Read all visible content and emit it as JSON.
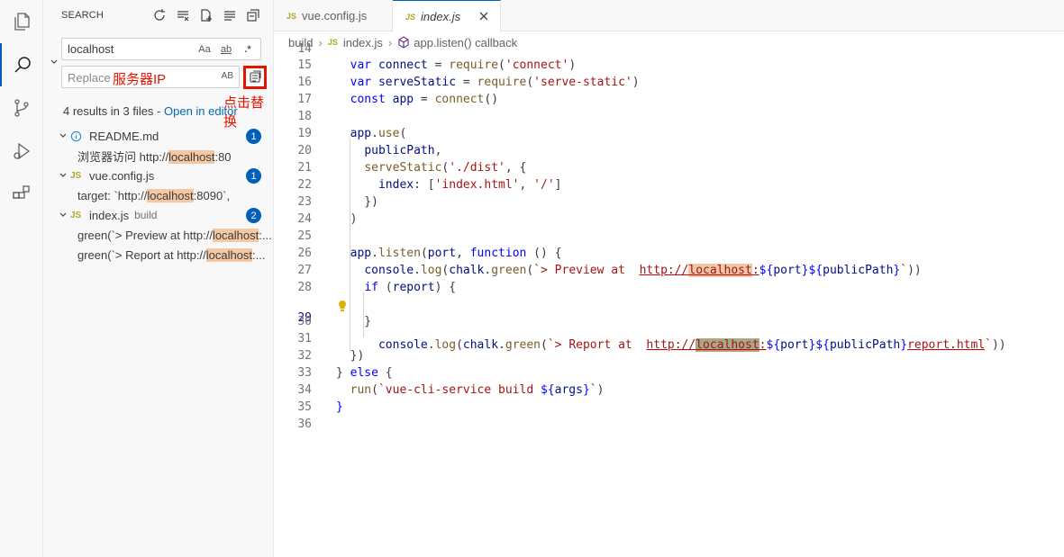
{
  "sidebar": {
    "title": "SEARCH",
    "search_value": "localhost",
    "search_opts": [
      "Aa",
      "ab",
      ".*"
    ],
    "replace_placeholder": "Replace",
    "replace_annotation": "服务器IP",
    "replace_ab": "AB",
    "replace_all_annotation": "点击替换",
    "results_text": "4 results in 3 files - ",
    "open_in_editor": "Open in editor",
    "files": [
      {
        "name": "README.md",
        "desc": "",
        "badge": "1",
        "matches": [
          {
            "pre": "浏览器访问 http://",
            "hit": "localhost",
            "post": ":80"
          }
        ]
      },
      {
        "name": "vue.config.js",
        "desc": "",
        "badge": "1",
        "matches": [
          {
            "pre": "target: `http://",
            "hit": "localhost",
            "post": ":8090`,"
          }
        ]
      },
      {
        "name": "index.js",
        "desc": "build",
        "badge": "2",
        "matches": [
          {
            "pre": "green(`> Preview at  http://",
            "hit": "localhost",
            "post": ":..."
          },
          {
            "pre": "green(`> Report at  http://",
            "hit": "localhost",
            "post": ":..."
          }
        ]
      }
    ]
  },
  "tabs": [
    {
      "label": "vue.config.js",
      "badge": "JS"
    },
    {
      "label": "index.js",
      "badge": "JS"
    }
  ],
  "breadcrumb": {
    "folder": "build",
    "file": "index.js",
    "symbol": "app.listen() callback"
  },
  "code": {
    "lines": [
      "14",
      "15",
      "16",
      "17",
      "18",
      "19",
      "20",
      "21",
      "22",
      "23",
      "24",
      "25",
      "26",
      "27",
      "28",
      "29",
      "30",
      "31",
      "32",
      "33",
      "34",
      "35",
      "36"
    ],
    "current_line": "29"
  }
}
